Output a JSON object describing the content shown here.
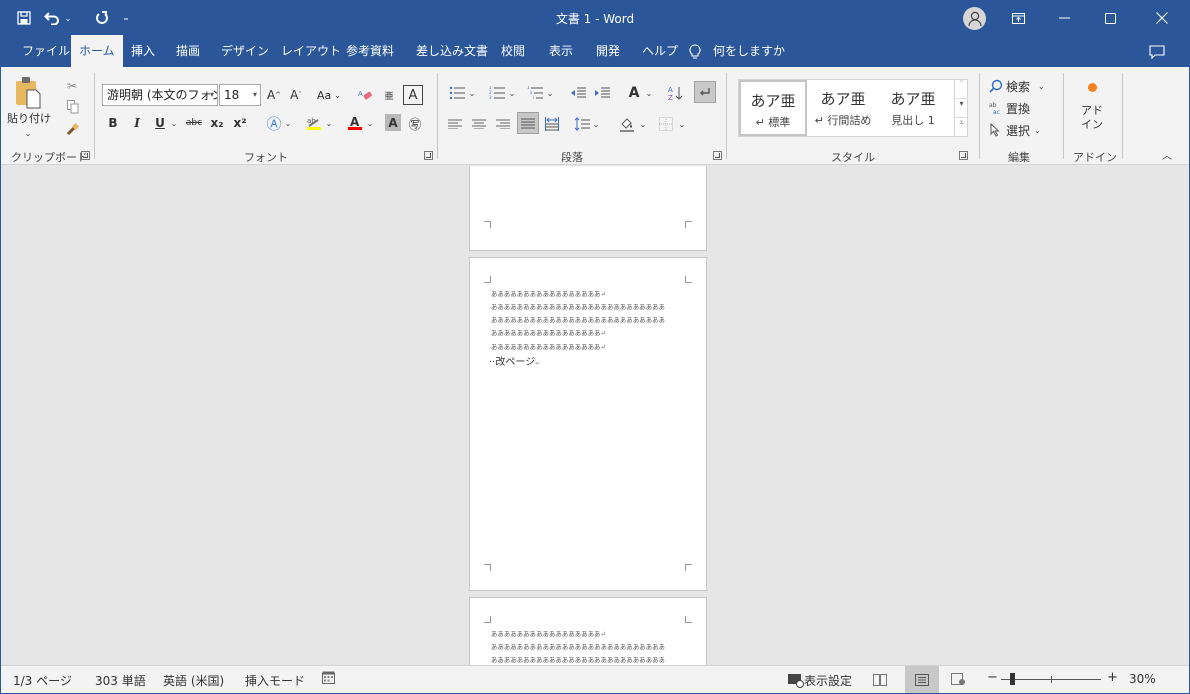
{
  "window": {
    "title": "文書 1  -  Word",
    "accent_color": "#2b579a"
  },
  "quick_access": {
    "save_icon": "save-icon",
    "undo_icon": "undo-icon",
    "redo_icon": "redo-icon",
    "customize_icon": "customize-icon"
  },
  "tabs": [
    {
      "label": "ファイル",
      "active": false
    },
    {
      "label": "ホーム",
      "active": true
    },
    {
      "label": "挿入",
      "active": false
    },
    {
      "label": "描画",
      "active": false
    },
    {
      "label": "デザイン",
      "active": false
    },
    {
      "label": "レイアウト",
      "active": false
    },
    {
      "label": "参考資料",
      "active": false
    },
    {
      "label": "差し込み文書",
      "active": false
    },
    {
      "label": "校閲",
      "active": false
    },
    {
      "label": "表示",
      "active": false
    },
    {
      "label": "開発",
      "active": false
    },
    {
      "label": "ヘルプ",
      "active": false
    }
  ],
  "tell_me": "何をしますか",
  "ribbon": {
    "clipboard": {
      "paste_label": "貼り付け",
      "group_label": "クリップボード"
    },
    "font": {
      "font_name": "游明朝 (本文のフォン",
      "font_size": "18",
      "group_label": "フォント",
      "change_case": "Aa",
      "bold": "B",
      "italic": "I",
      "underline": "U",
      "strike": "abc",
      "subscript": "x₂",
      "superscript": "x²",
      "highlight_color": "#ffff00",
      "font_color": "#ff0000"
    },
    "paragraph": {
      "group_label": "段落"
    },
    "styles": {
      "group_label": "スタイル",
      "items": [
        {
          "sample": "あア亜",
          "name": "↵ 標準",
          "selected": true
        },
        {
          "sample": "あア亜",
          "name": "↵ 行間詰め",
          "selected": false
        },
        {
          "sample": "あア亜",
          "name": "見出し 1",
          "selected": false
        }
      ]
    },
    "editing": {
      "group_label": "編集",
      "find": "検索",
      "replace": "置換",
      "select": "選択"
    },
    "addins": {
      "group_label": "アドイン",
      "button_line1": "アド",
      "button_line2": "イン",
      "dot_color": "#f7801e"
    }
  },
  "document": {
    "page2_lines": [
      "あああああああああああああああああ↵",
      "あああああああああああああああああああああああああああ",
      "あああああああああああああああああああああああああああ",
      "あああああああああああああああああ↵",
      "あああああああああああああああああ↵"
    ],
    "page_break_label": "改ページ",
    "page3_lines": [
      "あああああああああああああああああ↵",
      "あああああああああああああああああああああああああああ",
      "あああああああああああああああああああああああああああ"
    ]
  },
  "status": {
    "page": "1/3 ページ",
    "words": "303 単語",
    "language": "英語 (米国)",
    "mode": "挿入モード",
    "display_settings": "表示設定",
    "zoom_minus": "−",
    "zoom_plus": "+",
    "zoom_percent": "30%",
    "zoom_value": 30
  }
}
